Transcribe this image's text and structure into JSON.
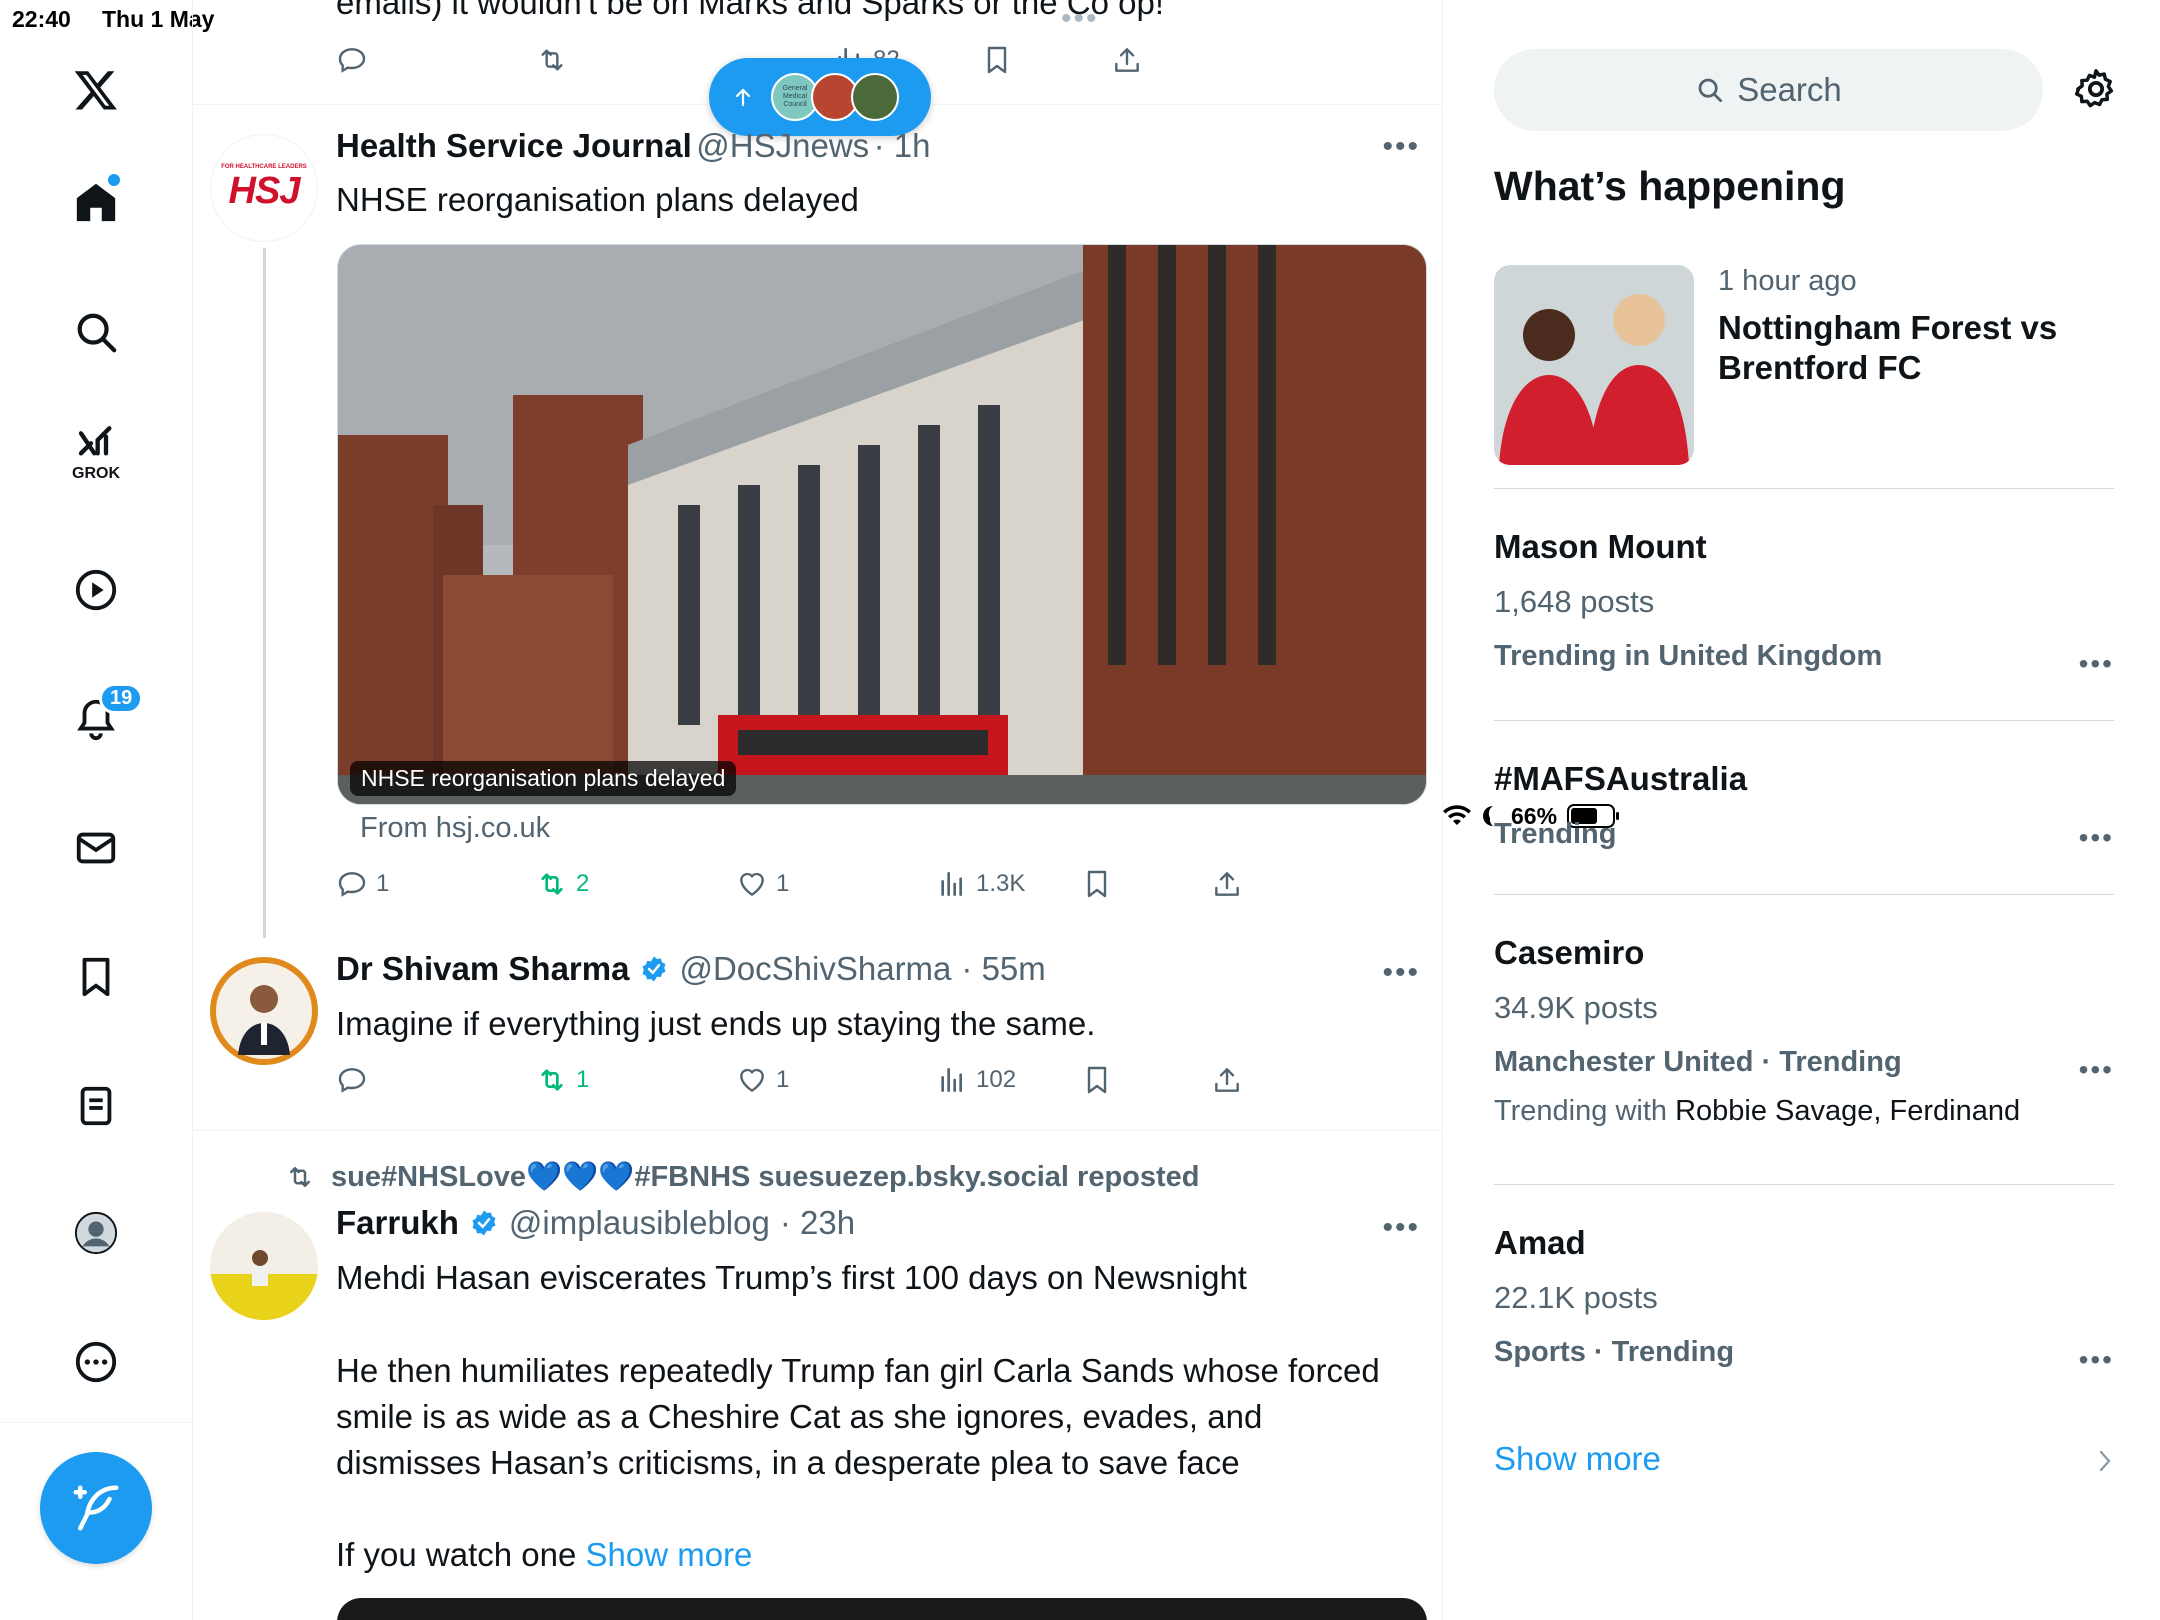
{
  "status_bar": {
    "time": "22:40",
    "date": "Thu 1 May",
    "battery": "66%",
    "battery_level": 0.66
  },
  "nav": {
    "grok_label": "GROK",
    "notifications_count": "19"
  },
  "new_posts_pill": {
    "label": "General Medical Council"
  },
  "top_partial": {
    "text": "emails) it wouldn't be on Marks and Sparks or the Co op!",
    "views": "82"
  },
  "post1": {
    "name": "Health Service Journal",
    "handle": "@HSJnews",
    "time": "· 1h",
    "text": "NHSE reorganisation plans delayed",
    "avatar_text": "HSJ",
    "avatar_small": "FOR HEALTHCARE LEADERS",
    "card_caption": "NHSE reorganisation plans delayed",
    "card_from": "From hsj.co.uk",
    "replies": "1",
    "reposts": "2",
    "likes": "1",
    "views": "1.3K"
  },
  "post2": {
    "name": "Dr Shivam Sharma",
    "handle": "@DocShivSharma",
    "time": "· 55m",
    "text": "Imagine if everything just ends up staying the same.",
    "reposts": "1",
    "likes": "1",
    "views": "102"
  },
  "post3": {
    "repost_line": "sue#NHSLove💙💙💙#FBNHS suesuezep.bsky.social reposted",
    "name": "Farrukh",
    "handle": "@implausibleblog",
    "time": "· 23h",
    "line1": "Mehdi Hasan eviscerates Trump’s first 100 days on Newsnight",
    "para2_line1": "He then humiliates repeatedly Trump fan girl Carla Sands whose forced",
    "para2_line2": "smile is as wide as a Cheshire Cat as she ignores, evades, and",
    "para2_line3": "dismisses Hasan’s criticisms, in a desperate plea to save face",
    "para3": "If you watch one",
    "show_more": "Show more"
  },
  "right": {
    "search_placeholder": "Search",
    "title": "What’s happening",
    "featured": {
      "time": "1 hour ago",
      "title_line1": "Nottingham Forest vs",
      "title_line2": "Brentford FC"
    },
    "trends": [
      {
        "title": "Mason Mount",
        "sub": "1,648 posts",
        "ctx": "Trending in United Kingdom"
      },
      {
        "title": "#MAFSAustralia",
        "ctx": "Trending"
      },
      {
        "title": "Casemiro",
        "sub": "34.9K posts",
        "ctx": "Manchester United · Trending",
        "with_prefix": "Trending with",
        "with_names": "Robbie Savage, Ferdinand"
      },
      {
        "title": "Amad",
        "sub": "22.1K posts",
        "ctx": "Sports · Trending"
      }
    ],
    "show_more": "Show more"
  },
  "colors": {
    "accent": "#1d9bf0",
    "repost_green": "#00ba7c",
    "muted": "#536471"
  }
}
